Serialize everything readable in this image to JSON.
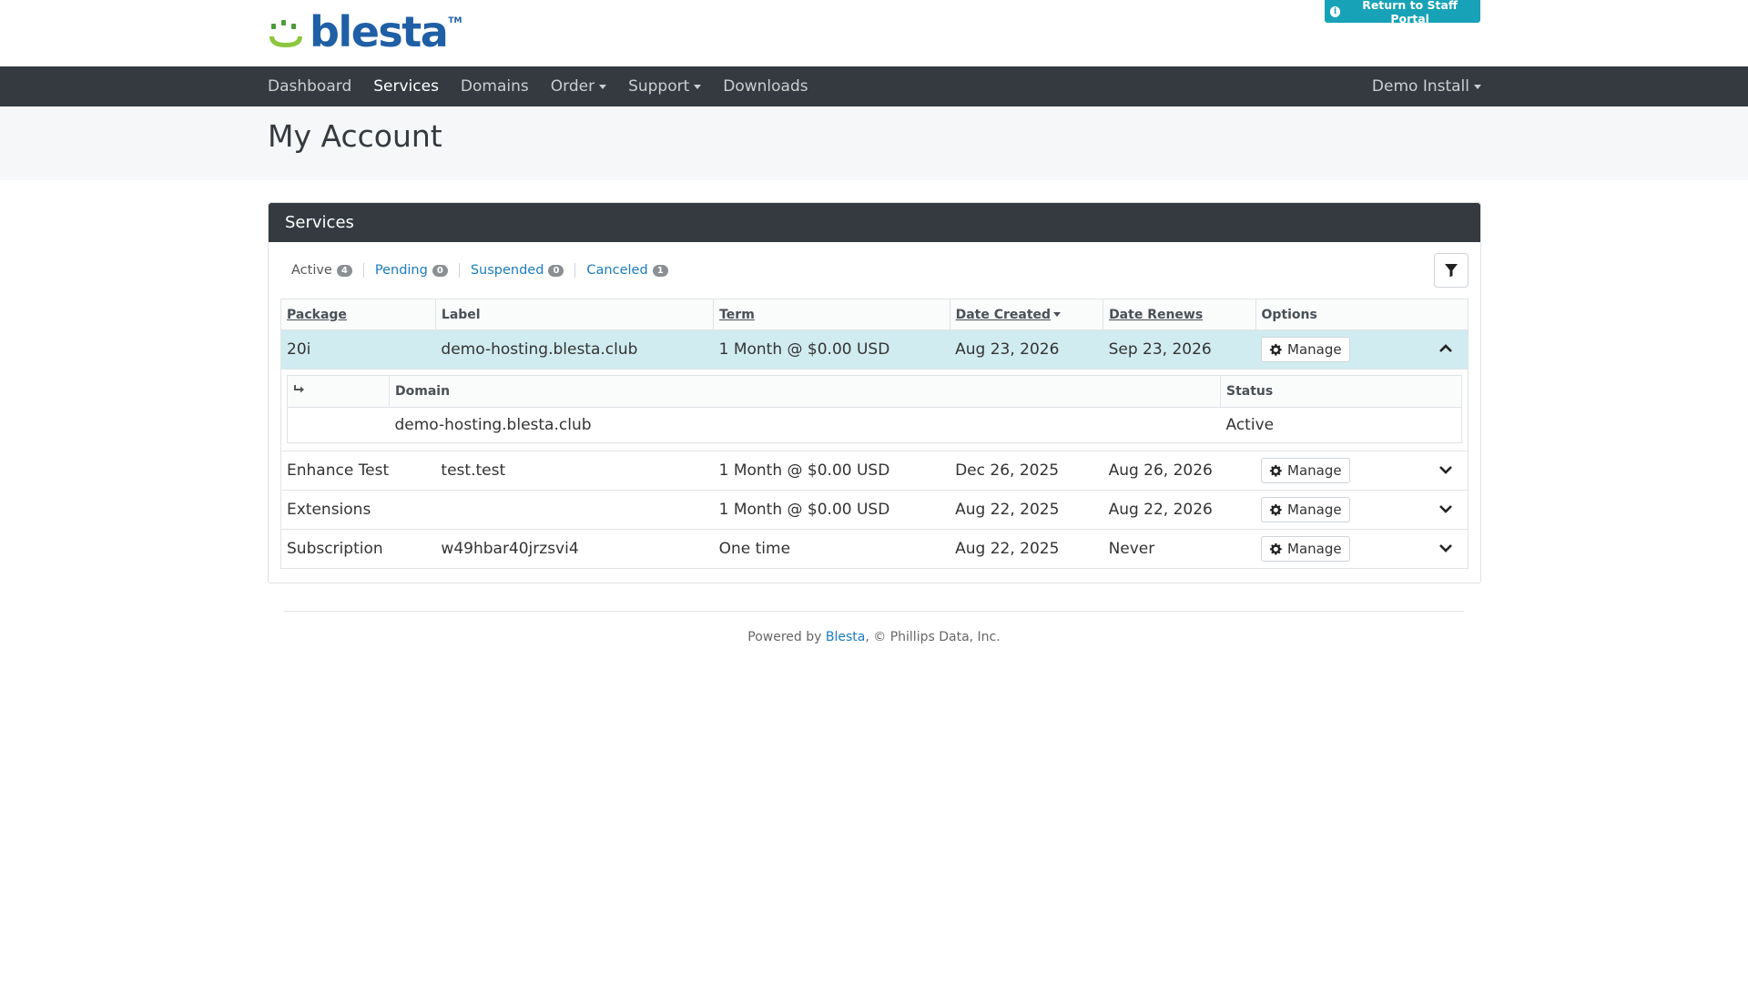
{
  "header": {
    "logo_text": "blesta",
    "logo_tm": "TM",
    "staff_portal_label": "Return to Staff Portal"
  },
  "nav": {
    "items": [
      {
        "label": "Dashboard"
      },
      {
        "label": "Services"
      },
      {
        "label": "Domains"
      },
      {
        "label": "Order"
      },
      {
        "label": "Support"
      },
      {
        "label": "Downloads"
      }
    ],
    "account_label": "Demo Install"
  },
  "page": {
    "title": "My Account"
  },
  "services": {
    "card_title": "Services",
    "status_tabs": [
      {
        "label": "Active",
        "count": "4"
      },
      {
        "label": "Pending",
        "count": "0"
      },
      {
        "label": "Suspended",
        "count": "0"
      },
      {
        "label": "Canceled",
        "count": "1"
      }
    ],
    "columns": {
      "package": "Package",
      "label": "Label",
      "term": "Term",
      "date_created": "Date Created",
      "date_renews": "Date Renews",
      "options": "Options"
    },
    "rows": [
      {
        "package": "20i",
        "label": "demo-hosting.blesta.club",
        "term": "1 Month @ $0.00 USD",
        "date_created": "Aug 23, 2026",
        "date_renews": "Sep 23, 2026",
        "manage": "Manage"
      },
      {
        "package": "Enhance Test",
        "label": "test.test",
        "term": "1 Month @ $0.00 USD",
        "date_created": "Dec 26, 2025",
        "date_renews": "Aug 26, 2026",
        "manage": "Manage"
      },
      {
        "package": "Extensions",
        "label": "",
        "term": "1 Month @ $0.00 USD",
        "date_created": "Aug 22, 2025",
        "date_renews": "Aug 22, 2026",
        "manage": "Manage"
      },
      {
        "package": "Subscription",
        "label": "w49hbar40jrzsvi4",
        "term": "One time",
        "date_created": "Aug 22, 2025",
        "date_renews": "Never",
        "manage": "Manage"
      }
    ],
    "sub_table": {
      "col_domain": "Domain",
      "col_status": "Status",
      "domain": "demo-hosting.blesta.club",
      "status": "Active"
    }
  },
  "footer": {
    "prefix": "Powered by ",
    "link": "Blesta",
    "suffix": ", © Phillips Data, Inc."
  }
}
